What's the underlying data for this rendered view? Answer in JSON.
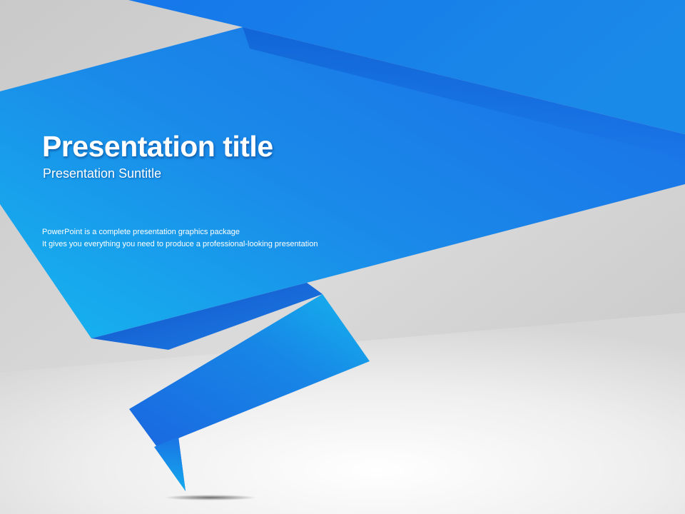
{
  "slide": {
    "title": "Presentation title",
    "subtitle": "Presentation Suntitle",
    "body_lines": [
      "PowerPoint is a complete presentation graphics package",
      "It gives you everything you need to produce a professional-looking presentation"
    ]
  },
  "colors": {
    "background_light": "#f4f4f4",
    "background_gray": "#cfcfcf",
    "accent_blue": "#1a7fe8",
    "accent_light_blue": "#13b0ec",
    "accent_dark_blue": "#1560d8",
    "text": "#ffffff"
  }
}
